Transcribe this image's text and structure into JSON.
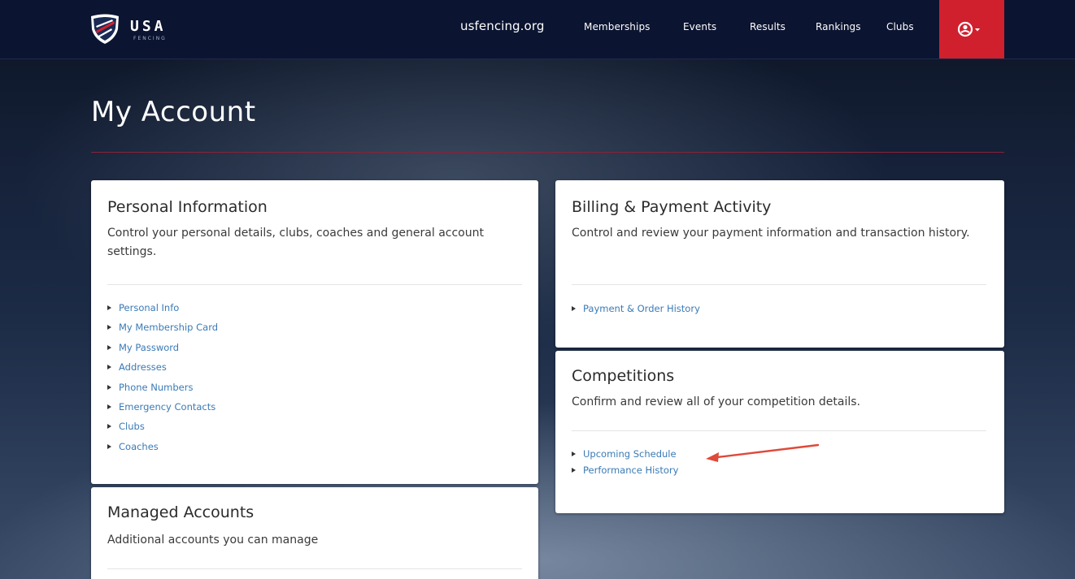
{
  "brand": {
    "logo_text": "USA",
    "logo_subtext": "FENCING"
  },
  "nav": {
    "site": "usfencing.org",
    "items": [
      {
        "label": "Memberships"
      },
      {
        "label": "Events"
      },
      {
        "label": "Results"
      },
      {
        "label": "Rankings"
      },
      {
        "label": "Clubs"
      }
    ],
    "user_icon": "user-circle-icon",
    "caret_icon": "caret-down-icon"
  },
  "page": {
    "title": "My Account"
  },
  "cards": {
    "personal": {
      "title": "Personal Information",
      "description": "Control your personal details, clubs, coaches and general account settings.",
      "links": [
        {
          "label": "Personal Info"
        },
        {
          "label": "My Membership Card"
        },
        {
          "label": "My Password"
        },
        {
          "label": "Addresses"
        },
        {
          "label": "Phone Numbers"
        },
        {
          "label": "Emergency Contacts"
        },
        {
          "label": "Clubs"
        },
        {
          "label": "Coaches"
        }
      ]
    },
    "billing": {
      "title": "Billing & Payment Activity",
      "description": "Control and review your payment information and transaction history.",
      "links": [
        {
          "label": "Payment & Order History"
        }
      ]
    },
    "competitions": {
      "title": "Competitions",
      "description": "Confirm and review all of your competition details.",
      "links": [
        {
          "label": "Upcoming Schedule"
        },
        {
          "label": "Performance History"
        }
      ]
    },
    "managed": {
      "title": "Managed Accounts",
      "description": "Additional accounts you can manage"
    }
  },
  "colors": {
    "accent_red": "#d0202e",
    "link_blue": "#3a7ab5",
    "nav_bg": "#0b1430",
    "annotation_arrow": "#e0483a"
  }
}
